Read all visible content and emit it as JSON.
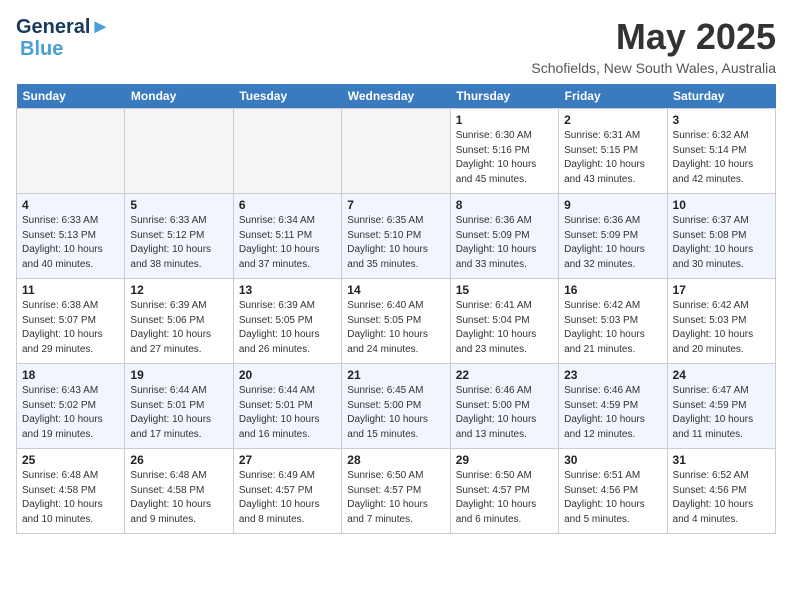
{
  "header": {
    "logo_line1": "General",
    "logo_line2": "Blue",
    "month": "May 2025",
    "location": "Schofields, New South Wales, Australia"
  },
  "days_of_week": [
    "Sunday",
    "Monday",
    "Tuesday",
    "Wednesday",
    "Thursday",
    "Friday",
    "Saturday"
  ],
  "weeks": [
    [
      {
        "num": "",
        "info": ""
      },
      {
        "num": "",
        "info": ""
      },
      {
        "num": "",
        "info": ""
      },
      {
        "num": "",
        "info": ""
      },
      {
        "num": "1",
        "info": "Sunrise: 6:30 AM\nSunset: 5:16 PM\nDaylight: 10 hours\nand 45 minutes."
      },
      {
        "num": "2",
        "info": "Sunrise: 6:31 AM\nSunset: 5:15 PM\nDaylight: 10 hours\nand 43 minutes."
      },
      {
        "num": "3",
        "info": "Sunrise: 6:32 AM\nSunset: 5:14 PM\nDaylight: 10 hours\nand 42 minutes."
      }
    ],
    [
      {
        "num": "4",
        "info": "Sunrise: 6:33 AM\nSunset: 5:13 PM\nDaylight: 10 hours\nand 40 minutes."
      },
      {
        "num": "5",
        "info": "Sunrise: 6:33 AM\nSunset: 5:12 PM\nDaylight: 10 hours\nand 38 minutes."
      },
      {
        "num": "6",
        "info": "Sunrise: 6:34 AM\nSunset: 5:11 PM\nDaylight: 10 hours\nand 37 minutes."
      },
      {
        "num": "7",
        "info": "Sunrise: 6:35 AM\nSunset: 5:10 PM\nDaylight: 10 hours\nand 35 minutes."
      },
      {
        "num": "8",
        "info": "Sunrise: 6:36 AM\nSunset: 5:09 PM\nDaylight: 10 hours\nand 33 minutes."
      },
      {
        "num": "9",
        "info": "Sunrise: 6:36 AM\nSunset: 5:09 PM\nDaylight: 10 hours\nand 32 minutes."
      },
      {
        "num": "10",
        "info": "Sunrise: 6:37 AM\nSunset: 5:08 PM\nDaylight: 10 hours\nand 30 minutes."
      }
    ],
    [
      {
        "num": "11",
        "info": "Sunrise: 6:38 AM\nSunset: 5:07 PM\nDaylight: 10 hours\nand 29 minutes."
      },
      {
        "num": "12",
        "info": "Sunrise: 6:39 AM\nSunset: 5:06 PM\nDaylight: 10 hours\nand 27 minutes."
      },
      {
        "num": "13",
        "info": "Sunrise: 6:39 AM\nSunset: 5:05 PM\nDaylight: 10 hours\nand 26 minutes."
      },
      {
        "num": "14",
        "info": "Sunrise: 6:40 AM\nSunset: 5:05 PM\nDaylight: 10 hours\nand 24 minutes."
      },
      {
        "num": "15",
        "info": "Sunrise: 6:41 AM\nSunset: 5:04 PM\nDaylight: 10 hours\nand 23 minutes."
      },
      {
        "num": "16",
        "info": "Sunrise: 6:42 AM\nSunset: 5:03 PM\nDaylight: 10 hours\nand 21 minutes."
      },
      {
        "num": "17",
        "info": "Sunrise: 6:42 AM\nSunset: 5:03 PM\nDaylight: 10 hours\nand 20 minutes."
      }
    ],
    [
      {
        "num": "18",
        "info": "Sunrise: 6:43 AM\nSunset: 5:02 PM\nDaylight: 10 hours\nand 19 minutes."
      },
      {
        "num": "19",
        "info": "Sunrise: 6:44 AM\nSunset: 5:01 PM\nDaylight: 10 hours\nand 17 minutes."
      },
      {
        "num": "20",
        "info": "Sunrise: 6:44 AM\nSunset: 5:01 PM\nDaylight: 10 hours\nand 16 minutes."
      },
      {
        "num": "21",
        "info": "Sunrise: 6:45 AM\nSunset: 5:00 PM\nDaylight: 10 hours\nand 15 minutes."
      },
      {
        "num": "22",
        "info": "Sunrise: 6:46 AM\nSunset: 5:00 PM\nDaylight: 10 hours\nand 13 minutes."
      },
      {
        "num": "23",
        "info": "Sunrise: 6:46 AM\nSunset: 4:59 PM\nDaylight: 10 hours\nand 12 minutes."
      },
      {
        "num": "24",
        "info": "Sunrise: 6:47 AM\nSunset: 4:59 PM\nDaylight: 10 hours\nand 11 minutes."
      }
    ],
    [
      {
        "num": "25",
        "info": "Sunrise: 6:48 AM\nSunset: 4:58 PM\nDaylight: 10 hours\nand 10 minutes."
      },
      {
        "num": "26",
        "info": "Sunrise: 6:48 AM\nSunset: 4:58 PM\nDaylight: 10 hours\nand 9 minutes."
      },
      {
        "num": "27",
        "info": "Sunrise: 6:49 AM\nSunset: 4:57 PM\nDaylight: 10 hours\nand 8 minutes."
      },
      {
        "num": "28",
        "info": "Sunrise: 6:50 AM\nSunset: 4:57 PM\nDaylight: 10 hours\nand 7 minutes."
      },
      {
        "num": "29",
        "info": "Sunrise: 6:50 AM\nSunset: 4:57 PM\nDaylight: 10 hours\nand 6 minutes."
      },
      {
        "num": "30",
        "info": "Sunrise: 6:51 AM\nSunset: 4:56 PM\nDaylight: 10 hours\nand 5 minutes."
      },
      {
        "num": "31",
        "info": "Sunrise: 6:52 AM\nSunset: 4:56 PM\nDaylight: 10 hours\nand 4 minutes."
      }
    ]
  ]
}
